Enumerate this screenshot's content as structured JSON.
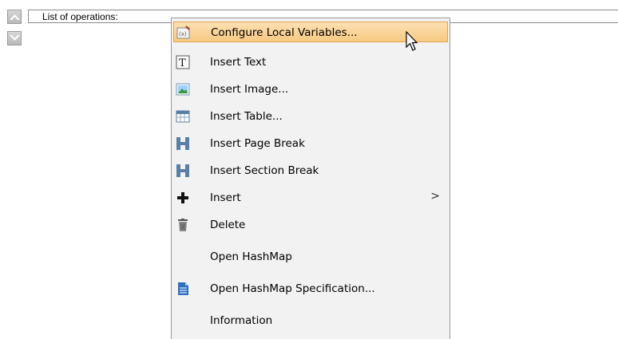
{
  "field": {
    "label": "List of operations:"
  },
  "menu": {
    "items": [
      {
        "label": "Configure Local Variables...",
        "icon": "variables-icon",
        "highlighted": true
      },
      {
        "label": "Insert Text",
        "icon": "text-icon"
      },
      {
        "label": "Insert Image...",
        "icon": "image-icon"
      },
      {
        "label": "Insert Table...",
        "icon": "table-icon"
      },
      {
        "label": "Insert Page Break",
        "icon": "page-break-icon"
      },
      {
        "label": "Insert Section Break",
        "icon": "section-break-icon"
      },
      {
        "label": "Insert",
        "icon": "plus-icon",
        "submenu_arrow": ">"
      },
      {
        "label": "Delete",
        "icon": "trash-icon"
      },
      {
        "label": "Open HashMap"
      },
      {
        "label": "Open HashMap Specification...",
        "icon": "document-icon"
      },
      {
        "label": "Information"
      }
    ]
  },
  "colors": {
    "highlight": "#f8c982",
    "menu_bg": "#f2f2f2"
  }
}
